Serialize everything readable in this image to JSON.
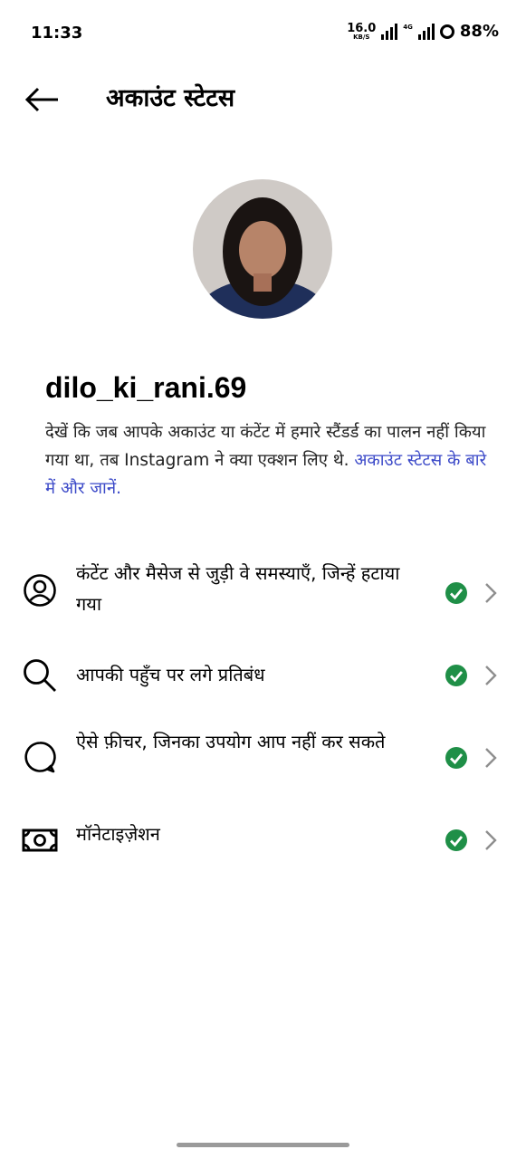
{
  "status_bar": {
    "time": "11:33",
    "net_speed_value": "16.0",
    "net_speed_unit": "KB/S",
    "net_type": "4G",
    "battery": "88%"
  },
  "header": {
    "back_icon": "arrow-left-icon",
    "title": "अकाउंट स्टेटस"
  },
  "profile": {
    "username": "dilo_ki_rani.69",
    "description": "देखें कि जब आपके अकाउंट या कंटेंट में हमारे स्टैंडर्ड का पालन नहीं किया गया था, तब Instagram ने क्या एक्शन लिए थे.",
    "learn_more_link": "अकाउंट स्टेटस के बारे में और जानें."
  },
  "status_items": [
    {
      "icon": "circle-person-icon",
      "label": "कंटेंट और मैसेज से जुड़ी वे समस्याएँ, जिन्हें हटाया गया",
      "status": "ok"
    },
    {
      "icon": "search-icon",
      "label": "आपकी पहुँच पर लगे प्रतिबंध",
      "status": "ok"
    },
    {
      "icon": "speech-bubble-icon",
      "label": "ऐसे फ़ीचर, जिनका उपयोग आप नहीं कर सकते",
      "status": "ok"
    },
    {
      "icon": "money-icon",
      "label": "मॉनेटाइज़ेशन",
      "status": "ok"
    }
  ],
  "colors": {
    "check_green": "#1f8f47",
    "link_blue": "#3b49c8",
    "chevron_gray": "#8e8e8e"
  }
}
